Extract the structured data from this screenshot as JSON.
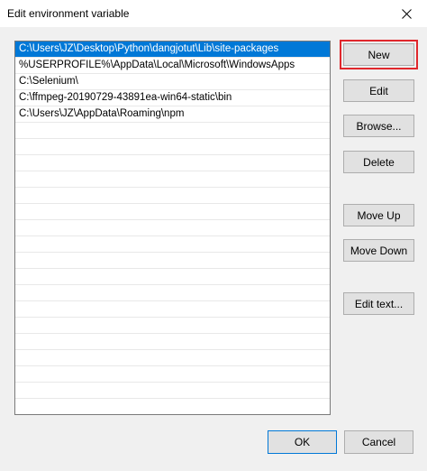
{
  "window": {
    "title": "Edit environment variable",
    "close_icon": "close-icon"
  },
  "path_list": {
    "items": [
      "C:\\Users\\JZ\\Desktop\\Python\\dangjotut\\Lib\\site-packages",
      "%USERPROFILE%\\AppData\\Local\\Microsoft\\WindowsApps",
      "C:\\Selenium\\",
      "C:\\ffmpeg-20190729-43891ea-win64-static\\bin",
      "C:\\Users\\JZ\\AppData\\Roaming\\npm"
    ],
    "selected_index": 0
  },
  "buttons": {
    "new": "New",
    "edit": "Edit",
    "browse": "Browse...",
    "delete": "Delete",
    "move_up": "Move Up",
    "move_down": "Move Down",
    "edit_text": "Edit text...",
    "ok": "OK",
    "cancel": "Cancel"
  },
  "colors": {
    "selection": "#0078d7",
    "highlight_outline": "#e0272c",
    "button_face": "#e1e1e1",
    "dialog_background": "#f0f0f0"
  }
}
